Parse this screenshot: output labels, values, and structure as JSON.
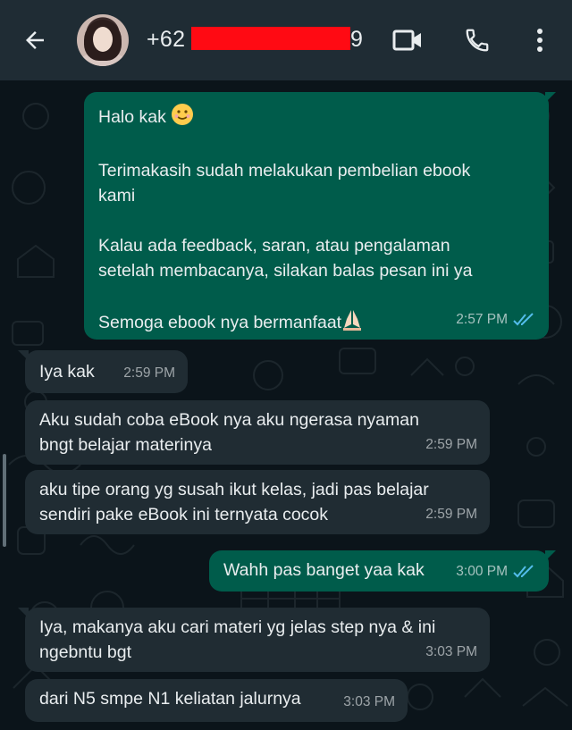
{
  "header": {
    "name_prefix": "+62 8",
    "name_suffix": "9"
  },
  "messages": [
    {
      "dir": "out",
      "lines": [
        "Halo kak",
        "",
        "Terimakasih sudah melakukan pembelian ebook\nkami",
        "",
        "Kalau ada feedback, saran, atau pengalaman\nsetelah membacanya, silakan balas pesan ini ya",
        "",
        "Semoga ebook nya bermanfaat"
      ],
      "time": "2:57 PM"
    },
    {
      "dir": "in",
      "text": "Iya kak",
      "time": "2:59 PM"
    },
    {
      "dir": "in",
      "text": "Aku sudah coba eBook nya aku ngerasa nyaman\nbngt belajar materinya",
      "time": "2:59 PM"
    },
    {
      "dir": "in",
      "text": "aku tipe orang yg susah ikut kelas, jadi pas belajar\nsendiri pake eBook ini ternyata cocok",
      "time": "2:59 PM"
    },
    {
      "dir": "out",
      "text": "Wahh pas banget yaa kak",
      "time": "3:00 PM"
    },
    {
      "dir": "in",
      "text": "Iya, makanya aku cari materi yg jelas step nya & ini\nngebntu bgt",
      "time": "3:03 PM"
    },
    {
      "dir": "in",
      "text": "dari N5 smpe N1 keliatan jalurnya",
      "time": "3:03 PM"
    }
  ],
  "colors": {
    "header_bg": "#1f2c34",
    "chat_bg": "#0b141a",
    "outgoing_bubble": "#005c4b",
    "incoming_bubble": "#202c33",
    "read_ticks": "#53bdeb",
    "redaction": "#ff0a13"
  },
  "icons": [
    "back-arrow-icon",
    "video-call-icon",
    "phone-icon",
    "more-vert-icon",
    "double-check-icon"
  ]
}
